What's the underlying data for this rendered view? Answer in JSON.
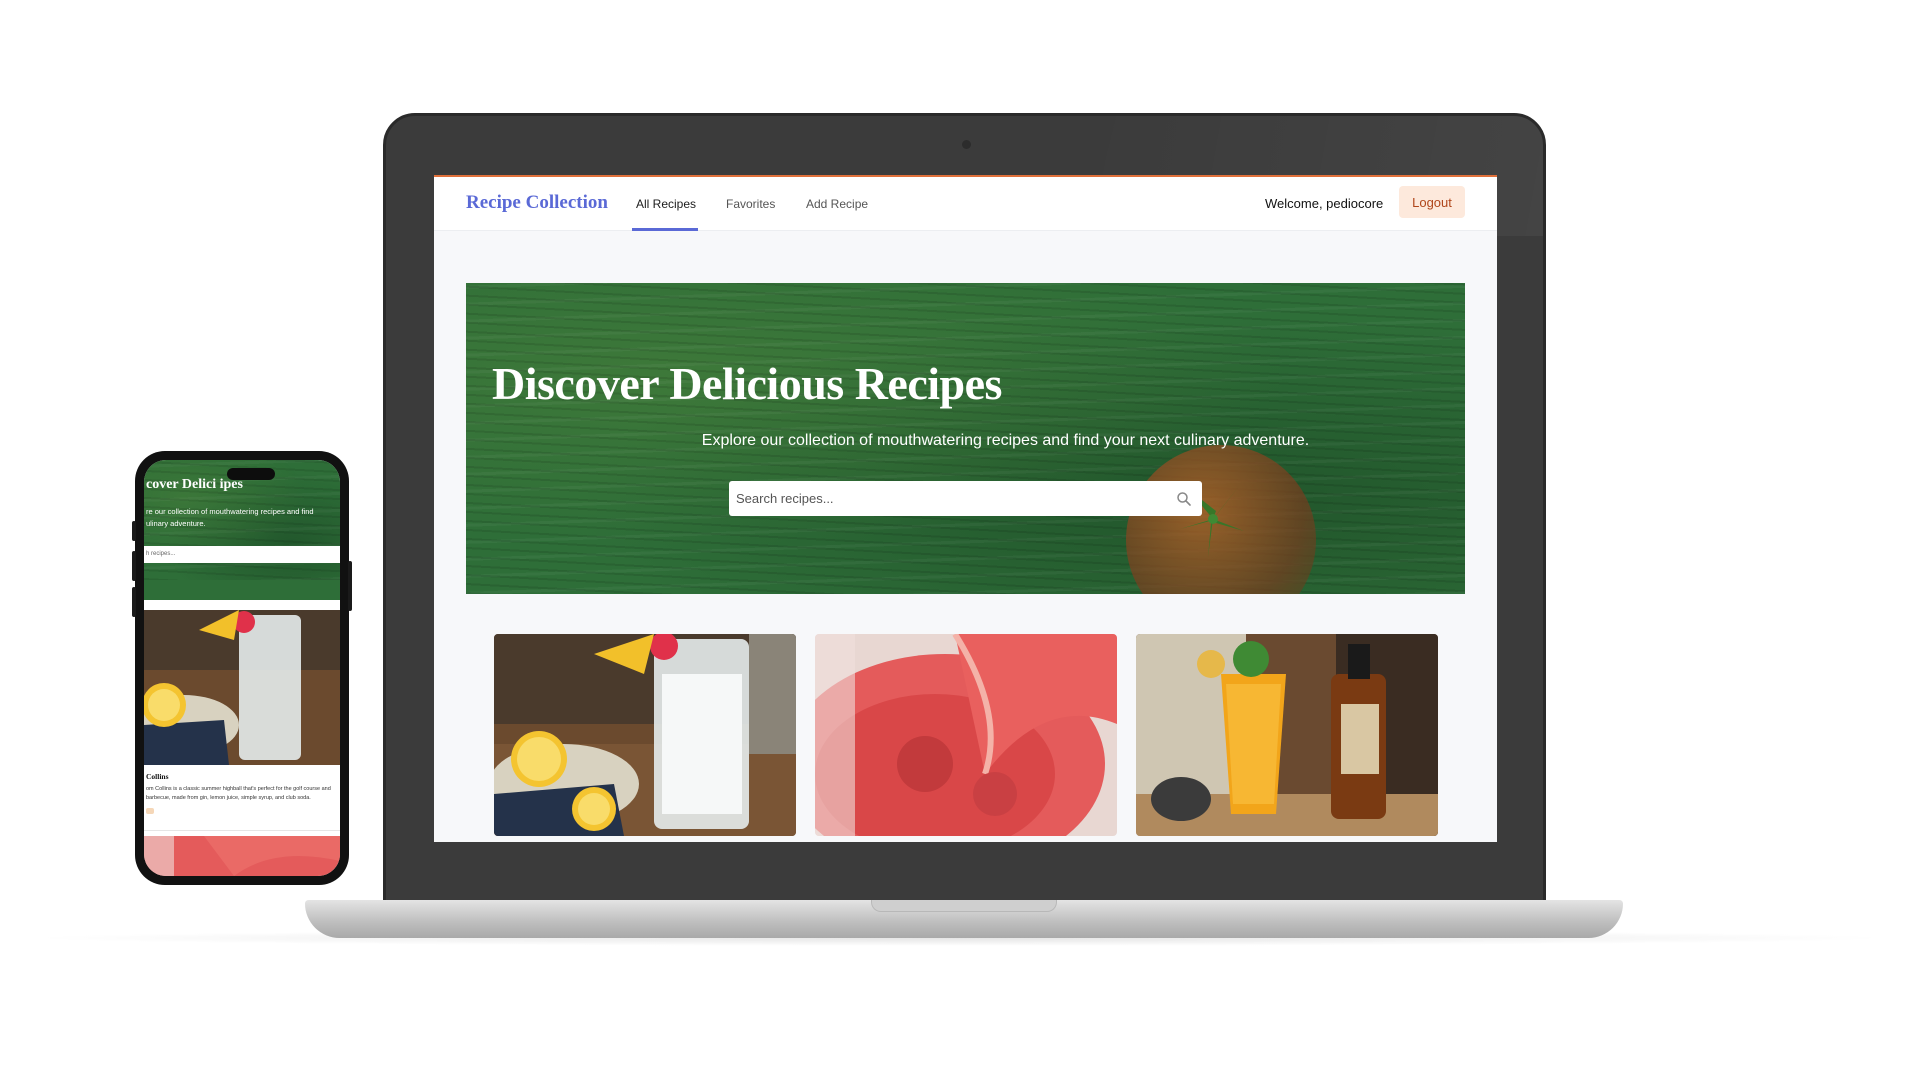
{
  "app": {
    "brand": "Recipe Collection",
    "nav": {
      "all_recipes": "All Recipes",
      "favorites": "Favorites",
      "add_recipe": "Add Recipe"
    },
    "welcome": "Welcome, pediocore",
    "logout": "Logout"
  },
  "hero": {
    "title": "Discover Delicious Recipes",
    "subtitle": "Explore our collection of mouthwatering recipes and find your next culinary adventure.",
    "search_placeholder": "Search recipes..."
  },
  "cards": [
    {
      "image": "lemon-highball-photo"
    },
    {
      "image": "watermelon-drink-photo"
    },
    {
      "image": "tropical-cocktail-photo"
    }
  ],
  "phone": {
    "hero_title": "cover Delici    ipes",
    "hero_subtitle": "re our collection of mouthwatering recipes and find\nulinary adventure.",
    "search_placeholder": "h recipes...",
    "card_title": "Collins",
    "card_desc": "om Collins is a classic summer highball that's perfect for the golf course and barbecue, made from gin, lemon juice, simple syrup, and club soda."
  },
  "colors": {
    "accent": "#5a69d6",
    "hero_green": "#2e6e38",
    "logout_bg": "#fde9dc",
    "logout_text": "#b0461b",
    "laptop_frame": "#3b3b3b"
  }
}
